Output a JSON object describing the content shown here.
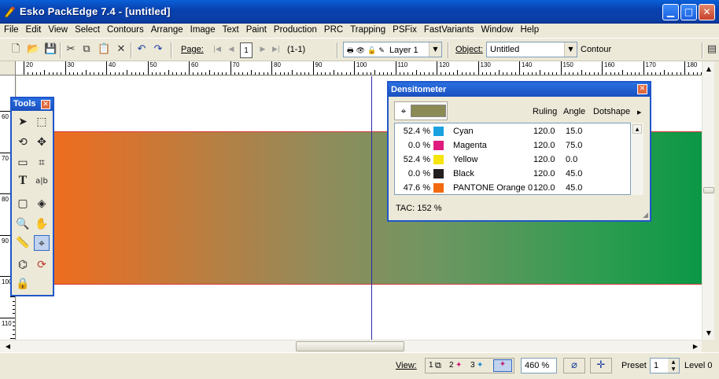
{
  "window": {
    "title": "Esko PackEdge 7.4 - [untitled]",
    "controls": [
      "minimize",
      "maximize",
      "close"
    ]
  },
  "menu": [
    "File",
    "Edit",
    "View",
    "Select",
    "Contours",
    "Arrange",
    "Image",
    "Text",
    "Paint",
    "Production",
    "PRC",
    "Trapping",
    "PSFix",
    "FastVariants",
    "Window",
    "Help"
  ],
  "toolbar": {
    "page_label": "Page:",
    "page_number": "1",
    "page_range": "(1-1)",
    "layer_value": "Layer 1",
    "object_label": "Object:",
    "object_value": "Untitled",
    "contour_label": "Contour"
  },
  "ruler": {
    "top_labels": [
      "20",
      "30",
      "40",
      "50",
      "60",
      "70",
      "80",
      "90",
      "100",
      "110",
      "120",
      "130",
      "140",
      "150",
      "160",
      "170",
      "180"
    ],
    "left_labels": [
      "60",
      "70",
      "80",
      "90",
      "100",
      "110"
    ]
  },
  "tools_panel": {
    "title": "Tools"
  },
  "densitometer": {
    "title": "Densitometer",
    "headers": {
      "ruling": "Ruling",
      "angle": "Angle",
      "dotshape": "Dotshape"
    },
    "sample_color": "#8b8b55",
    "rows": [
      {
        "percent": "52.4 %",
        "color": "#1aa1e0",
        "name": "Cyan",
        "ruling": "120.0",
        "angle": "15.0"
      },
      {
        "percent": "0.0 %",
        "color": "#e0197f",
        "name": "Magenta",
        "ruling": "120.0",
        "angle": "75.0"
      },
      {
        "percent": "52.4 %",
        "color": "#f5e50a",
        "name": "Yellow",
        "ruling": "120.0",
        "angle": "0.0"
      },
      {
        "percent": "0.0 %",
        "color": "#231f20",
        "name": "Black",
        "ruling": "120.0",
        "angle": "45.0"
      },
      {
        "percent": "47.6 %",
        "color": "#f26a10",
        "name": "PANTONE Orange 0",
        "ruling": "120.0",
        "angle": "45.0"
      }
    ],
    "tac": "TAC:  152 %"
  },
  "statusbar": {
    "view_label": "View:",
    "view_modes": [
      "1",
      "2",
      "3"
    ],
    "zoom": "460 %",
    "preset_label": "Preset",
    "preset_value": "1",
    "level_label": "Level 0"
  }
}
